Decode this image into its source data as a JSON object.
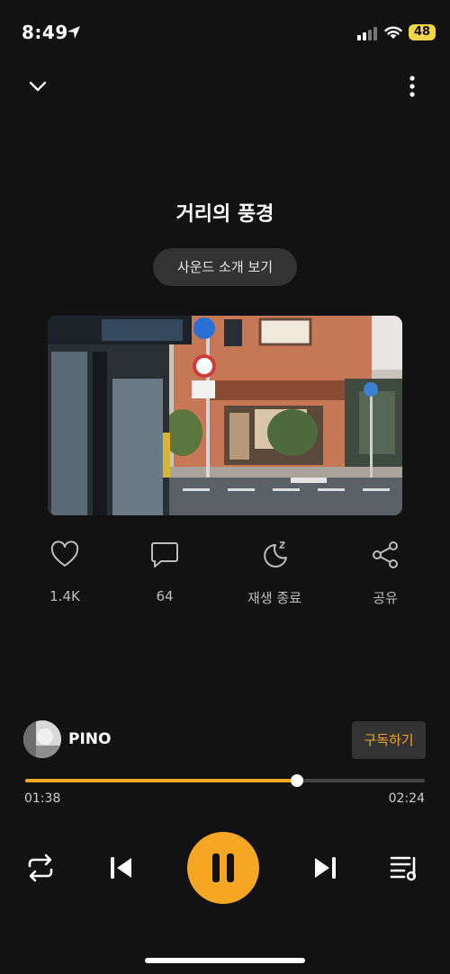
{
  "status": {
    "time": "8:49",
    "battery": "48"
  },
  "track": {
    "title": "거리의 풍경",
    "intro_button": "사운드 소개 보기"
  },
  "actions": {
    "like": {
      "label": "1.4K",
      "icon": "heart-icon"
    },
    "comment": {
      "label": "64",
      "icon": "comment-icon"
    },
    "sleep": {
      "label": "재생 종료",
      "icon": "moon-icon"
    },
    "share": {
      "label": "공유",
      "icon": "share-icon"
    }
  },
  "artist": {
    "name": "PINO",
    "subscribe_label": "구독하기"
  },
  "player": {
    "current_time": "01:38",
    "total_time": "02:24",
    "progress": 0.68,
    "state": "playing"
  },
  "colors": {
    "accent": "#f5a623",
    "background": "#121212",
    "button_bg": "#333333"
  }
}
